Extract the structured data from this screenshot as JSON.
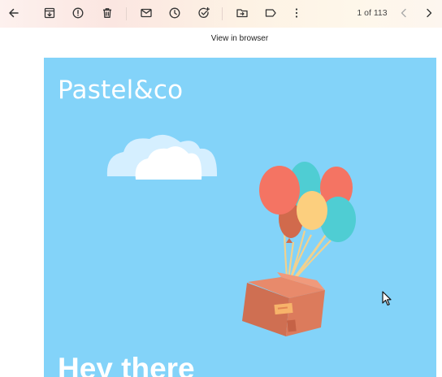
{
  "toolbar": {
    "back": {
      "icon": "arrow-left-icon"
    },
    "archive": {
      "icon": "archive-icon"
    },
    "report_spam": {
      "icon": "report-spam-icon"
    },
    "delete": {
      "icon": "trash-icon"
    },
    "mark_unread": {
      "icon": "mail-icon"
    },
    "snooze": {
      "icon": "clock-icon"
    },
    "add_task": {
      "icon": "add-task-icon"
    },
    "move_to": {
      "icon": "move-to-folder-icon"
    },
    "label": {
      "icon": "label-icon"
    },
    "more": {
      "icon": "more-vert-icon"
    },
    "pager": "1 of 113",
    "prev": {
      "icon": "chevron-left-icon"
    },
    "next": {
      "icon": "chevron-right-icon"
    }
  },
  "view_in_browser": "View in browser",
  "email": {
    "brand": "Pastel&co",
    "headline": "Hey there",
    "background_color": "#83d3f9"
  },
  "colors": {
    "toolbar_bg": "#fbe8e2",
    "email_bg": "#83d3f9",
    "balloon_red": "#f47463",
    "balloon_teal": "#4fcdd3",
    "balloon_yellow": "#fccf7e",
    "box": "#d97b5c"
  }
}
